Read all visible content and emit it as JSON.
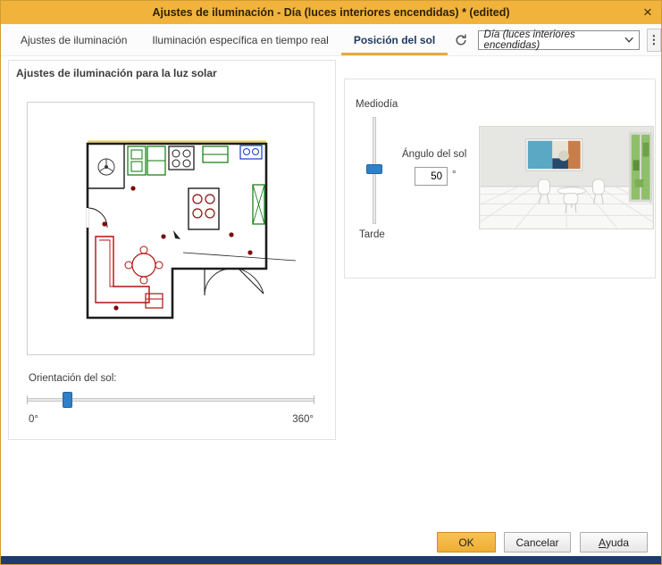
{
  "window": {
    "title": "Ajustes de iluminación - Día (luces interiores encendidas) * (edited)",
    "close_icon": "×"
  },
  "tabs": [
    {
      "label": "Ajustes de iluminación"
    },
    {
      "label": "Iluminación específica en tiempo real"
    },
    {
      "label": "Posición del sol"
    }
  ],
  "active_tab": "Posición del sol",
  "toolbar": {
    "refresh_icon": "refresh-circular-arrow",
    "preset_value": "Día (luces interiores encendidas)",
    "menu_icon": "⋮"
  },
  "sun_panel": {
    "header": "Ajustes de iluminación para la luz solar",
    "orientation": {
      "label": "Orientación del sol:",
      "min": "0°",
      "max": "360°",
      "handle_percent": 14
    }
  },
  "elevation_panel": {
    "top_label": "Mediodía",
    "bottom_label": "Tarde",
    "angle_label": "Ángulo del sol",
    "angle_value": "50",
    "angle_unit": "°",
    "slider_percent_from_top": 48
  },
  "footer": {
    "ok": "OK",
    "cancel": "Cancelar",
    "help_first": "A",
    "help_rest": "yuda"
  },
  "colors": {
    "titlebar": "#F1B33C",
    "accent": "#E9A93D",
    "active_tab_text": "#1F3864",
    "slider_handle": "#2F80C8",
    "bottom_strip": "#1F3A6C",
    "ok_button": "#F2B63F"
  }
}
